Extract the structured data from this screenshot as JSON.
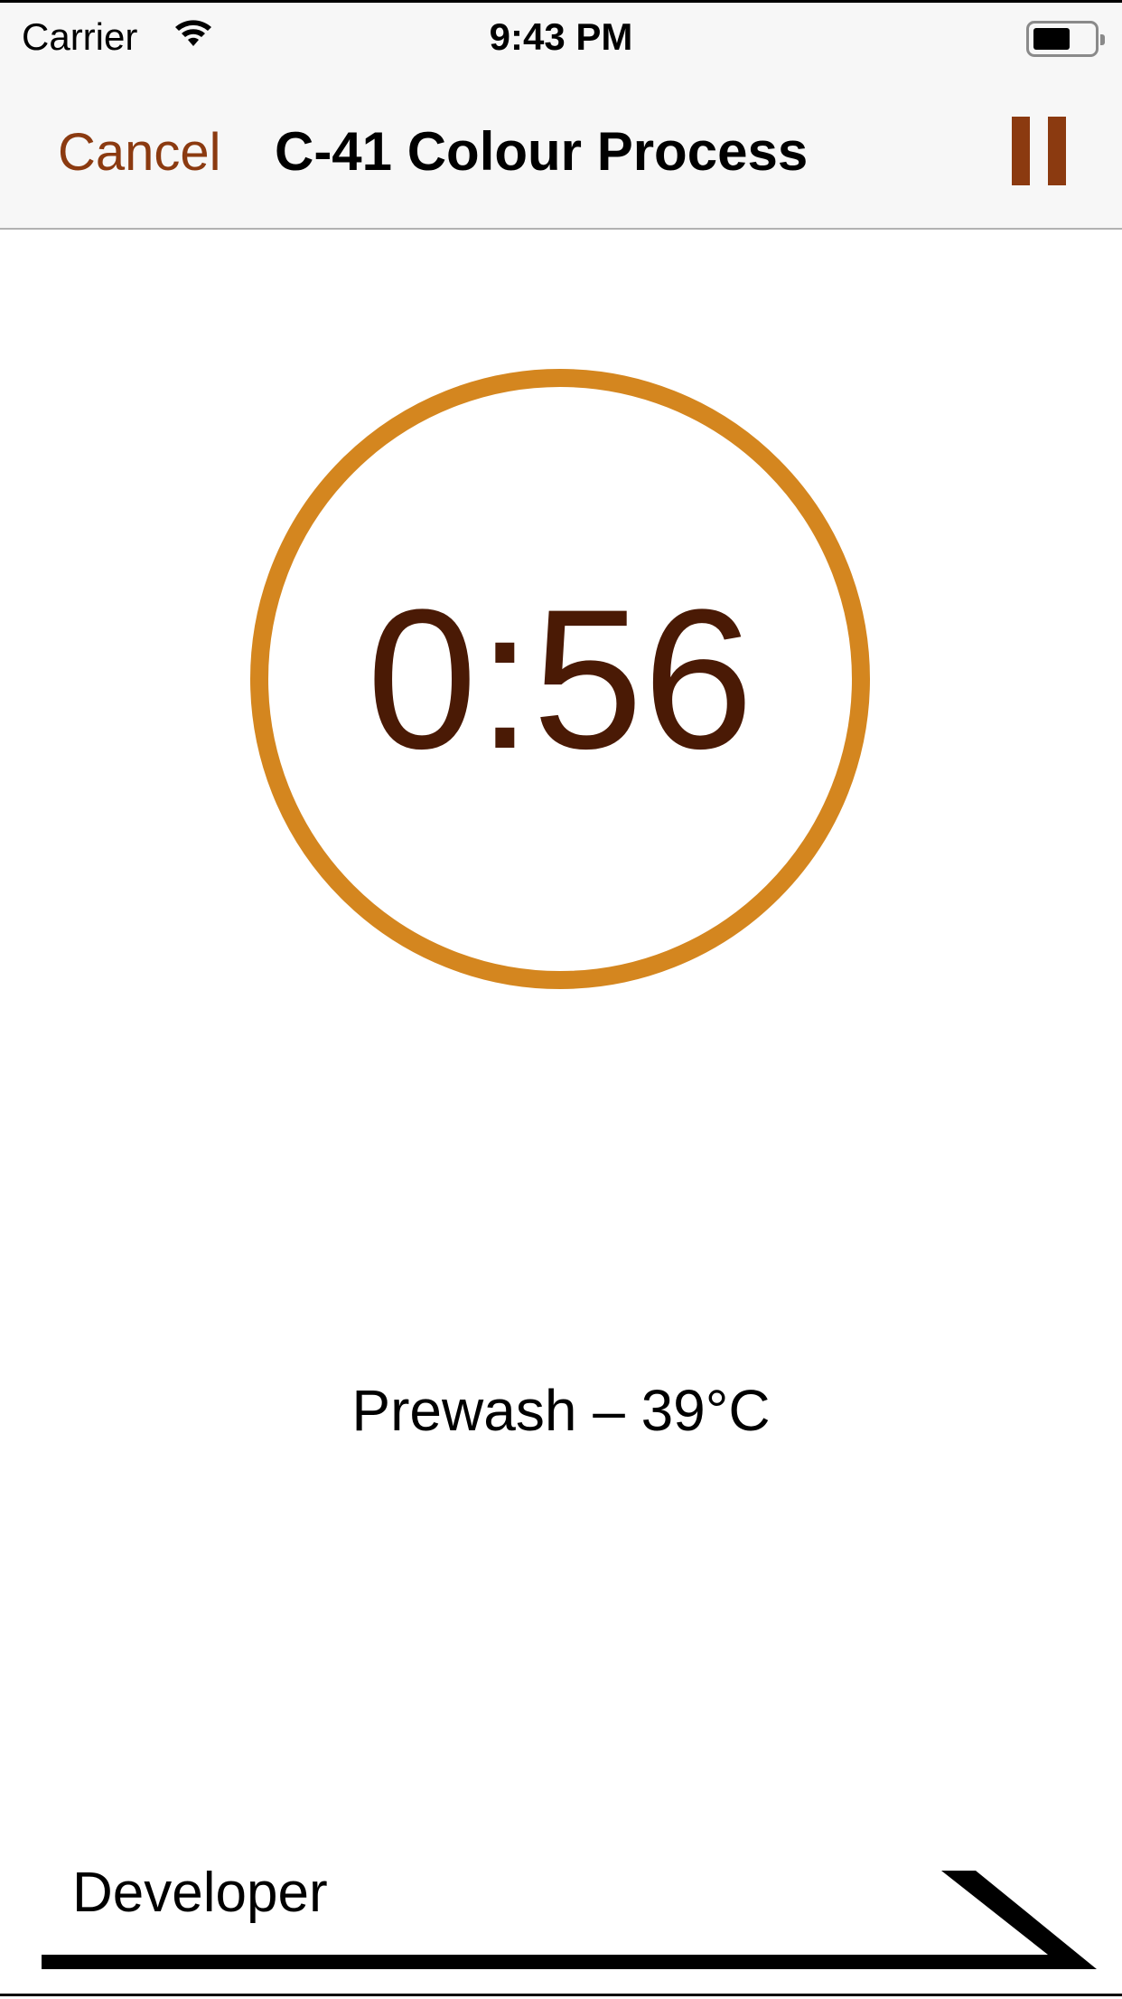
{
  "status_bar": {
    "carrier": "Carrier",
    "time": "9:43 PM",
    "battery_level": 0.5
  },
  "nav": {
    "cancel_label": "Cancel",
    "title": "C-41 Colour Process",
    "pause_icon": "pause-icon"
  },
  "timer": {
    "remaining": "0:56",
    "progress": 1.0,
    "ring_color": "#D4861F",
    "text_color": "#4A1A05"
  },
  "step": {
    "label": "Prewash – 39°C"
  },
  "next_step": {
    "label": "Developer",
    "icon": "arrow-right-icon"
  },
  "colors": {
    "accent": "#8B3A10"
  }
}
